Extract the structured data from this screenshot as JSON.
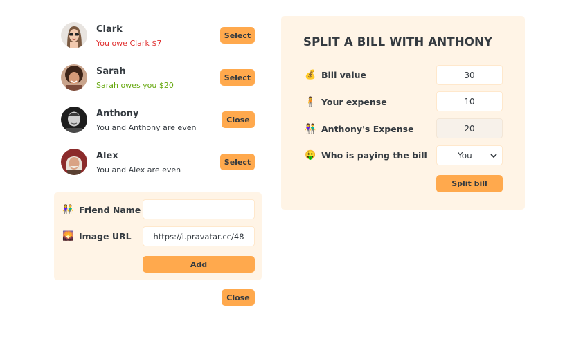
{
  "friends": [
    {
      "name": "Clark",
      "status": "You owe Clark $7",
      "status_kind": "red",
      "button": "Select"
    },
    {
      "name": "Sarah",
      "status": "Sarah owes you $20",
      "status_kind": "green",
      "button": "Select"
    },
    {
      "name": "Anthony",
      "status": "You and Anthony are even",
      "status_kind": "even",
      "button": "Close"
    },
    {
      "name": "Alex",
      "status": "You and Alex are even",
      "status_kind": "even",
      "button": "Select"
    }
  ],
  "add_form": {
    "name_emoji": "👫",
    "name_label": "Friend Name",
    "name_value": "",
    "image_emoji": "🌄",
    "image_label": "Image URL",
    "image_value": "https://i.pravatar.cc/48",
    "add_button": "Add"
  },
  "close_form_button": "Close",
  "split": {
    "title": "SPLIT A BILL WITH ANTHONY",
    "bill_emoji": "💰",
    "bill_label": "Bill value",
    "bill_value": "30",
    "expense_emoji": "🧍",
    "expense_label": "Your expense",
    "expense_value": "10",
    "friend_emoji": "👫",
    "friend_label": "Anthony's Expense",
    "friend_value": "20",
    "payer_emoji": "🤑",
    "payer_label": "Who is paying the bill",
    "payer_value": "You",
    "submit_button": "Split bill"
  },
  "colors": {
    "accent": "#ffa94d",
    "panel": "#fff4e6",
    "text": "#343a40",
    "owe_red": "#e03131",
    "owed_green": "#66a80f"
  }
}
